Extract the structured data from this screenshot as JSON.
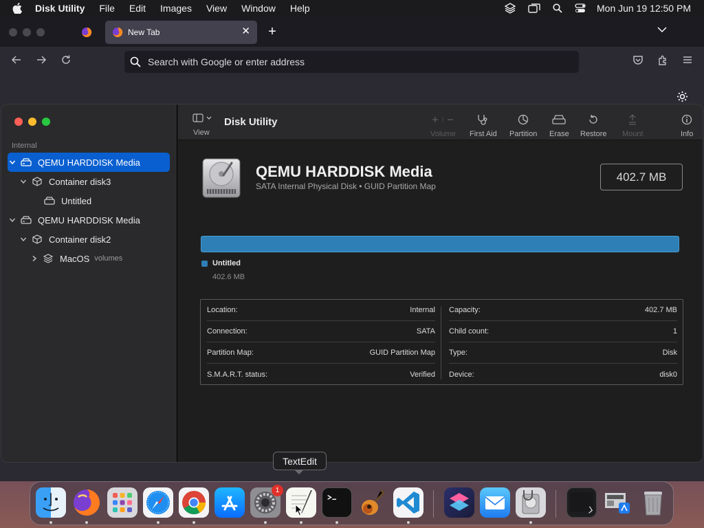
{
  "menubar": {
    "app_name": "Disk Utility",
    "items": [
      "File",
      "Edit",
      "Images",
      "View",
      "Window",
      "Help"
    ],
    "clock": "Mon Jun 19  12:50 PM"
  },
  "firefox": {
    "tab_title": "New Tab",
    "url_placeholder": "Search with Google or enter address"
  },
  "disk_utility": {
    "sidebar": {
      "section": "Internal",
      "items": [
        {
          "label": "QEMU HARDDISK Media",
          "sub": ""
        },
        {
          "label": "Container disk3",
          "sub": ""
        },
        {
          "label": "Untitled",
          "sub": ""
        },
        {
          "label": "QEMU HARDDISK Media",
          "sub": ""
        },
        {
          "label": "Container disk2",
          "sub": ""
        },
        {
          "label": "MacOS",
          "sub": "volumes"
        }
      ]
    },
    "toolbar": {
      "view_label": "View",
      "title": "Disk Utility",
      "volume": "Volume",
      "first_aid": "First Aid",
      "partition": "Partition",
      "erase": "Erase",
      "restore": "Restore",
      "mount": "Mount",
      "info": "Info"
    },
    "disk": {
      "name": "QEMU HARDDISK Media",
      "description": "SATA Internal Physical Disk • GUID Partition Map",
      "size": "402.7 MB"
    },
    "partition": {
      "name": "Untitled",
      "size": "402.6 MB",
      "color": "#2e7fb5"
    },
    "info_left": [
      {
        "label": "Location:",
        "value": "Internal"
      },
      {
        "label": "Connection:",
        "value": "SATA"
      },
      {
        "label": "Partition Map:",
        "value": "GUID Partition Map"
      },
      {
        "label": "S.M.A.R.T. status:",
        "value": "Verified"
      }
    ],
    "info_right": [
      {
        "label": "Capacity:",
        "value": "402.7 MB"
      },
      {
        "label": "Child count:",
        "value": "1"
      },
      {
        "label": "Type:",
        "value": "Disk"
      },
      {
        "label": "Device:",
        "value": "disk0"
      }
    ]
  },
  "tooltip": "TextEdit",
  "dock": {
    "apps": [
      "finder-icon",
      "firefox-icon",
      "launchpad-icon",
      "safari-icon",
      "chrome-icon",
      "app-store-icon",
      "system-settings-icon",
      "textedit-icon",
      "terminal-icon",
      "garageband-icon",
      "vscode-icon",
      "shortcuts-icon",
      "mail-icon",
      "disk-utility-icon",
      "screenshot-icon",
      "preview-icon",
      "trash-icon"
    ],
    "system_settings_badge": "1"
  }
}
